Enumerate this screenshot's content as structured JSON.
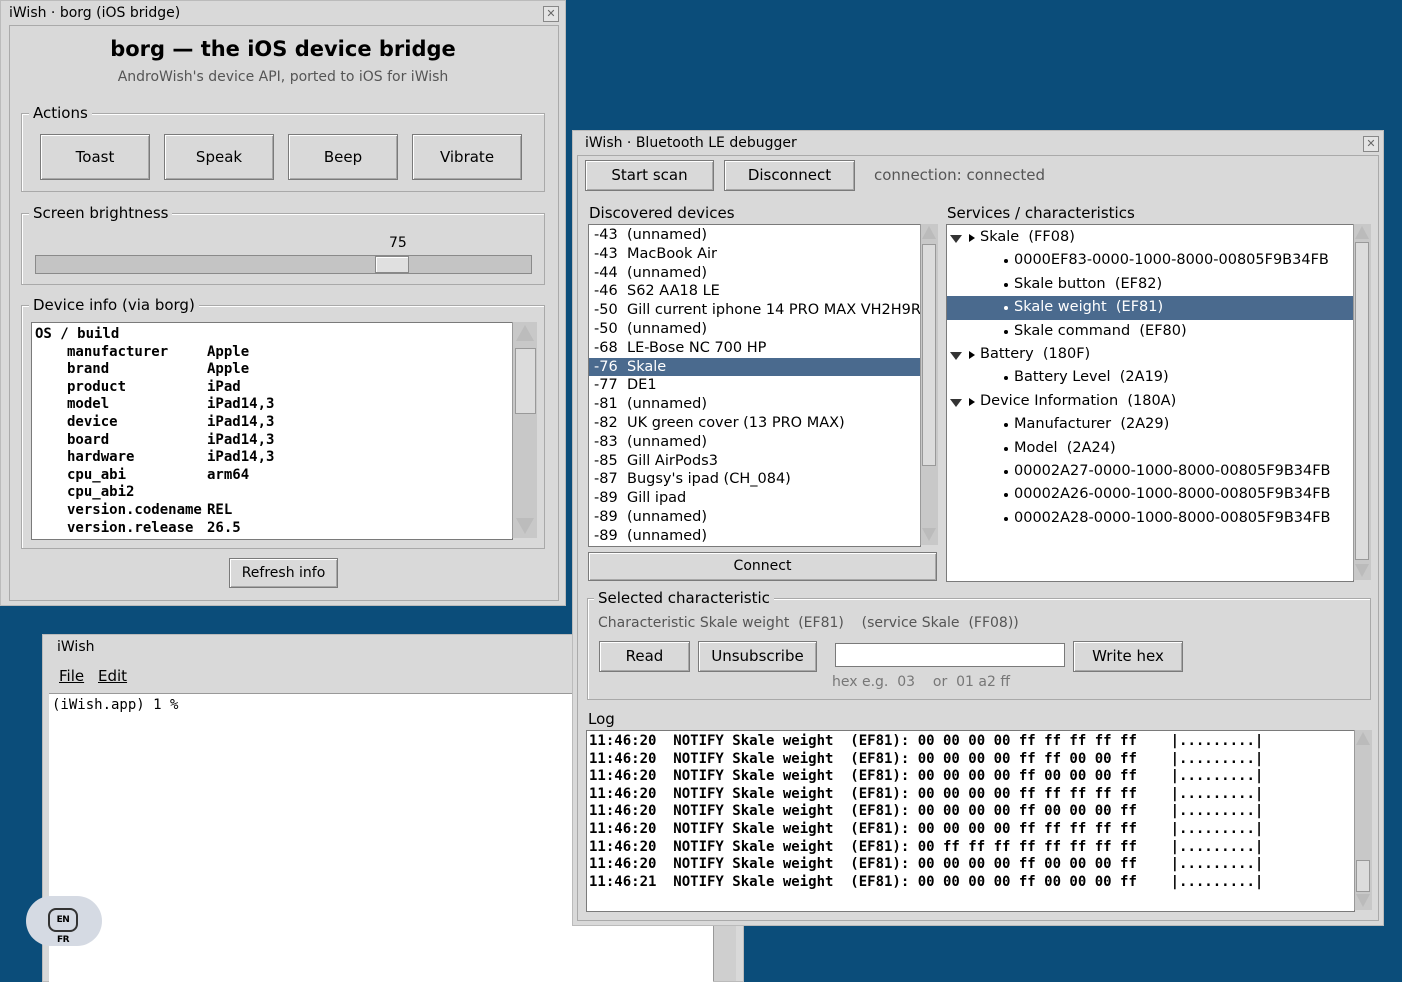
{
  "borg_window": {
    "title": "iWish · borg (iOS bridge)",
    "heading": "borg — the iOS device bridge",
    "subtitle": "AndroWish's device API, ported to iOS for iWish",
    "actions_label": "Actions",
    "actions": [
      "Toast",
      "Speak",
      "Beep",
      "Vibrate"
    ],
    "brightness_label": "Screen brightness",
    "brightness_value": "75",
    "brightness_level": 0.75,
    "device_info_label": "Device info (via borg)",
    "device_info_header": "OS / build",
    "device_info": [
      {
        "key": "manufacturer",
        "value": "Apple"
      },
      {
        "key": "brand",
        "value": "Apple"
      },
      {
        "key": "product",
        "value": "iPad"
      },
      {
        "key": "model",
        "value": "iPad14,3"
      },
      {
        "key": "device",
        "value": "iPad14,3"
      },
      {
        "key": "board",
        "value": "iPad14,3"
      },
      {
        "key": "hardware",
        "value": "iPad14,3"
      },
      {
        "key": "cpu_abi",
        "value": "arm64"
      },
      {
        "key": "cpu_abi2",
        "value": ""
      },
      {
        "key": "version.codename",
        "value": "REL"
      },
      {
        "key": "version.release",
        "value": "26.5"
      }
    ],
    "refresh_button": "Refresh info"
  },
  "console_window": {
    "title": "iWish",
    "menu": [
      "File",
      "Edit"
    ],
    "prompt": "(iWish.app) 1 %"
  },
  "keyboard_badge": "EN FR",
  "ble_window": {
    "title": "iWish · Bluetooth LE debugger",
    "start_scan": "Start scan",
    "disconnect": "Disconnect",
    "connection_status": "connection: connected",
    "devices_label": "Discovered devices",
    "devices": [
      {
        "rssi": "-43",
        "name": "(unnamed)"
      },
      {
        "rssi": "-43",
        "name": "MacBook Air"
      },
      {
        "rssi": "-44",
        "name": "(unnamed)"
      },
      {
        "rssi": "-46",
        "name": "S62 AA18 LE"
      },
      {
        "rssi": "-50",
        "name": "Gill current iphone 14 PRO MAX VH2H9RI"
      },
      {
        "rssi": "-50",
        "name": "(unnamed)"
      },
      {
        "rssi": "-68",
        "name": "LE-Bose NC 700 HP"
      },
      {
        "rssi": "-76",
        "name": "Skale",
        "selected": true
      },
      {
        "rssi": "-77",
        "name": "DE1"
      },
      {
        "rssi": "-81",
        "name": "(unnamed)"
      },
      {
        "rssi": "-82",
        "name": "UK green cover (13 PRO MAX)"
      },
      {
        "rssi": "-83",
        "name": "(unnamed)"
      },
      {
        "rssi": "-85",
        "name": "Gill AirPods3"
      },
      {
        "rssi": "-87",
        "name": "Bugsy's ipad (CH_084)"
      },
      {
        "rssi": "-89",
        "name": "Gill ipad"
      },
      {
        "rssi": "-89",
        "name": "(unnamed)"
      },
      {
        "rssi": "-89",
        "name": "(unnamed)"
      }
    ],
    "connect_button": "Connect",
    "services_label": "Services / characteristics",
    "services": [
      {
        "level": 0,
        "text": "Skale  (FF08)"
      },
      {
        "level": 1,
        "text": "0000EF83-0000-1000-8000-00805F9B34FB"
      },
      {
        "level": 1,
        "text": "Skale button  (EF82)"
      },
      {
        "level": 1,
        "text": "Skale weight  (EF81)",
        "selected": true
      },
      {
        "level": 1,
        "text": "Skale command  (EF80)"
      },
      {
        "level": 0,
        "text": "Battery  (180F)"
      },
      {
        "level": 1,
        "text": "Battery Level  (2A19)"
      },
      {
        "level": 0,
        "text": "Device Information  (180A)"
      },
      {
        "level": 1,
        "text": "Manufacturer  (2A29)"
      },
      {
        "level": 1,
        "text": "Model  (2A24)"
      },
      {
        "level": 1,
        "text": "00002A27-0000-1000-8000-00805F9B34FB"
      },
      {
        "level": 1,
        "text": "00002A26-0000-1000-8000-00805F9B34FB"
      },
      {
        "level": 1,
        "text": "00002A28-0000-1000-8000-00805F9B34FB"
      }
    ],
    "selected_label": "Selected characteristic",
    "selected_text": "Characteristic Skale weight  (EF81)    (service Skale  (FF08))",
    "read_button": "Read",
    "unsubscribe_button": "Unsubscribe",
    "hex_value": "",
    "write_hex_button": "Write hex",
    "hex_hint": "hex e.g.  03    or  01 a2 ff",
    "log_label": "Log",
    "log": [
      "11:46:20  NOTIFY Skale weight  (EF81): 00 00 00 00 ff ff ff ff ff    |.........|",
      "11:46:20  NOTIFY Skale weight  (EF81): 00 00 00 00 ff ff 00 00 ff    |.........|",
      "11:46:20  NOTIFY Skale weight  (EF81): 00 00 00 00 ff 00 00 00 ff    |.........|",
      "11:46:20  NOTIFY Skale weight  (EF81): 00 00 00 00 ff ff ff ff ff    |.........|",
      "11:46:20  NOTIFY Skale weight  (EF81): 00 00 00 00 ff 00 00 00 ff    |.........|",
      "11:46:20  NOTIFY Skale weight  (EF81): 00 00 00 00 ff ff ff ff ff    |.........|",
      "11:46:20  NOTIFY Skale weight  (EF81): 00 ff ff ff ff ff ff ff ff    |.........|",
      "11:46:20  NOTIFY Skale weight  (EF81): 00 00 00 00 ff 00 00 00 ff    |.........|",
      "11:46:21  NOTIFY Skale weight  (EF81): 00 00 00 00 ff 00 00 00 ff    |.........|"
    ]
  }
}
